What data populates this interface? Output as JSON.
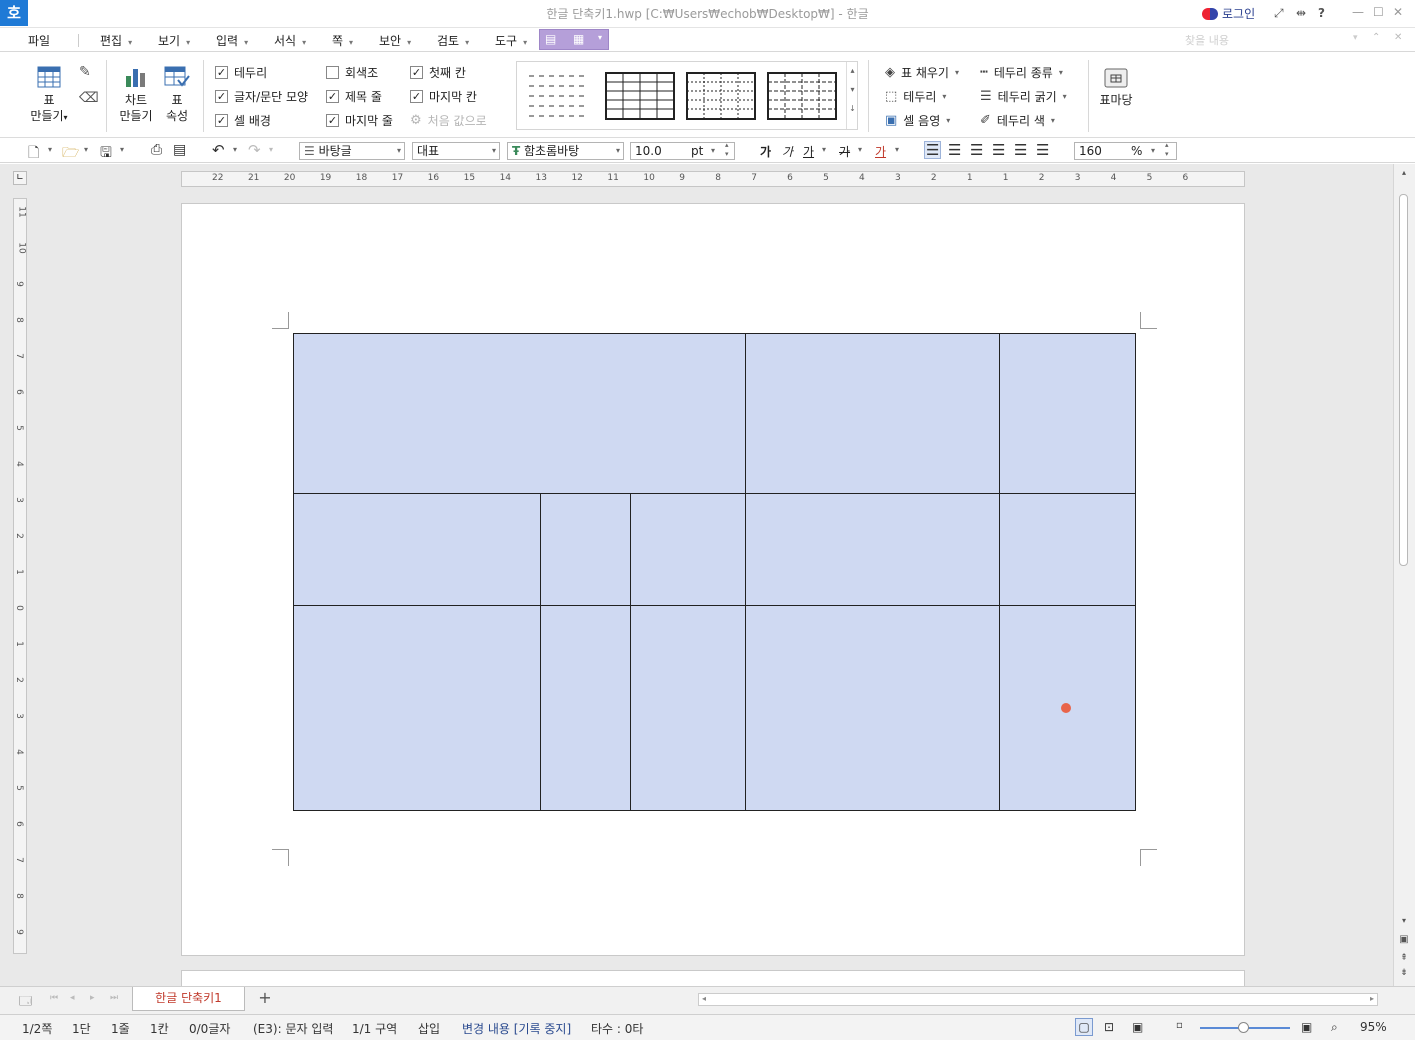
{
  "window": {
    "title": "한글 단축키1.hwp [C:₩Users₩echob₩Desktop₩] - 한글",
    "login": "로그인",
    "app_logo": "호"
  },
  "menu": {
    "file": "파일",
    "edit": "편집",
    "view": "보기",
    "input": "입력",
    "format": "서식",
    "page": "쪽",
    "security": "보안",
    "review": "검토",
    "tools": "도구",
    "search_placeholder": "찾을 내용"
  },
  "ribbon": {
    "make_table_1": "표",
    "make_table_2": "만들기",
    "chart_1": "차트",
    "chart_2": "만들기",
    "props_1": "표",
    "props_2": "속성",
    "checks": [
      {
        "label": "테두리",
        "checked": true
      },
      {
        "label": "글자/문단 모양",
        "checked": true
      },
      {
        "label": "셀 배경",
        "checked": true
      },
      {
        "label": "회색조",
        "checked": false
      },
      {
        "label": "제목 줄",
        "checked": true
      },
      {
        "label": "마지막 줄",
        "checked": true
      },
      {
        "label": "첫째 칸",
        "checked": true
      },
      {
        "label": "마지막 칸",
        "checked": true
      }
    ],
    "reset": "처음 값으로",
    "fill": "표 채우기",
    "border": "테두리",
    "shade": "셀 음영",
    "border_type": "테두리 종류",
    "border_width": "테두리 굵기",
    "border_color": "테두리 색",
    "table_corner": "표마당"
  },
  "toolbar": {
    "style": "바탕글",
    "lang": "대표",
    "font": "함초롬바탕",
    "size": "10.0",
    "unit": "pt",
    "zoom": "160",
    "zoom_unit": "%",
    "bold": "가",
    "italic": "가",
    "underline": "가",
    "strike": "가",
    "color_text": "가"
  },
  "ruler_h": [
    "22",
    "21",
    "20",
    "19",
    "18",
    "17",
    "16",
    "15",
    "14",
    "13",
    "12",
    "11",
    "10",
    "9",
    "8",
    "7",
    "6",
    "5",
    "4",
    "3",
    "2",
    "1",
    "1",
    "2",
    "3",
    "4",
    "5",
    "6"
  ],
  "ruler_v": [
    "11",
    "10",
    "9",
    "8",
    "7",
    "6",
    "5",
    "4",
    "3",
    "2",
    "1",
    "0",
    "1",
    "2",
    "3",
    "4",
    "5",
    "6",
    "7",
    "8",
    "9"
  ],
  "tab": {
    "doc_name": "한글 단축키1",
    "add": "+"
  },
  "status": {
    "page": "1/2쪽",
    "col": "1단",
    "line": "1줄",
    "cell": "1칸",
    "chars": "0/0글자",
    "mode": "(E3): 문자 입력",
    "section": "1/1 구역",
    "insert": "삽입",
    "track": "변경 내용 [기록 중지]",
    "typing": "타수 : 0타",
    "zoom": "95%"
  },
  "colors": {
    "cell_fill": "#cfd9f2",
    "marker": "#e8644a",
    "tab_text": "#c0392b",
    "selected_tab": "#b59fd9"
  }
}
